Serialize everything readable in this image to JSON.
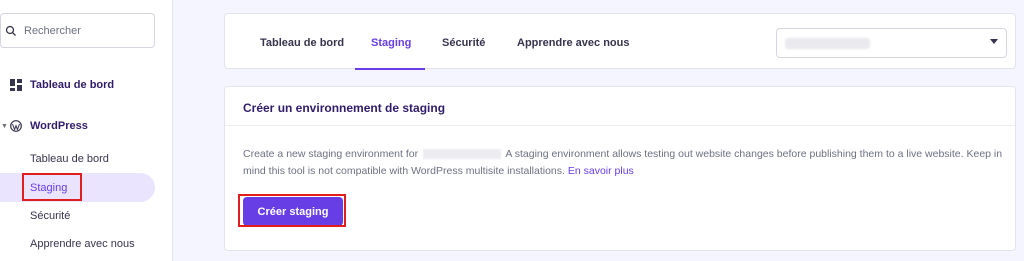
{
  "sidebar": {
    "search_placeholder": "Rechercher",
    "sections": [
      {
        "label": "Tableau de bord",
        "icon": "dashboard-icon"
      },
      {
        "label": "WordPress",
        "icon": "wordpress-icon"
      }
    ],
    "wordpress_items": [
      {
        "label": "Tableau de bord"
      },
      {
        "label": "Staging",
        "active": true
      },
      {
        "label": "Sécurité"
      },
      {
        "label": "Apprendre avec nous"
      }
    ]
  },
  "tabs": [
    {
      "label": "Tableau de bord"
    },
    {
      "label": "Staging",
      "active": true
    },
    {
      "label": "Sécurité"
    },
    {
      "label": "Apprendre avec nous"
    }
  ],
  "main": {
    "title": "Créer un environnement de staging",
    "description_start": "Create a new staging environment for",
    "description_end": "A staging environment allows testing out website changes before publishing them to a live website. Keep in mind this tool is not compatible with WordPress multisite installations.",
    "learn_more": "En savoir plus",
    "create_button": "Créer staging"
  },
  "colors": {
    "accent": "#673de6",
    "highlight_box": "#e01e1e",
    "page_background": "#f4f5ff"
  }
}
